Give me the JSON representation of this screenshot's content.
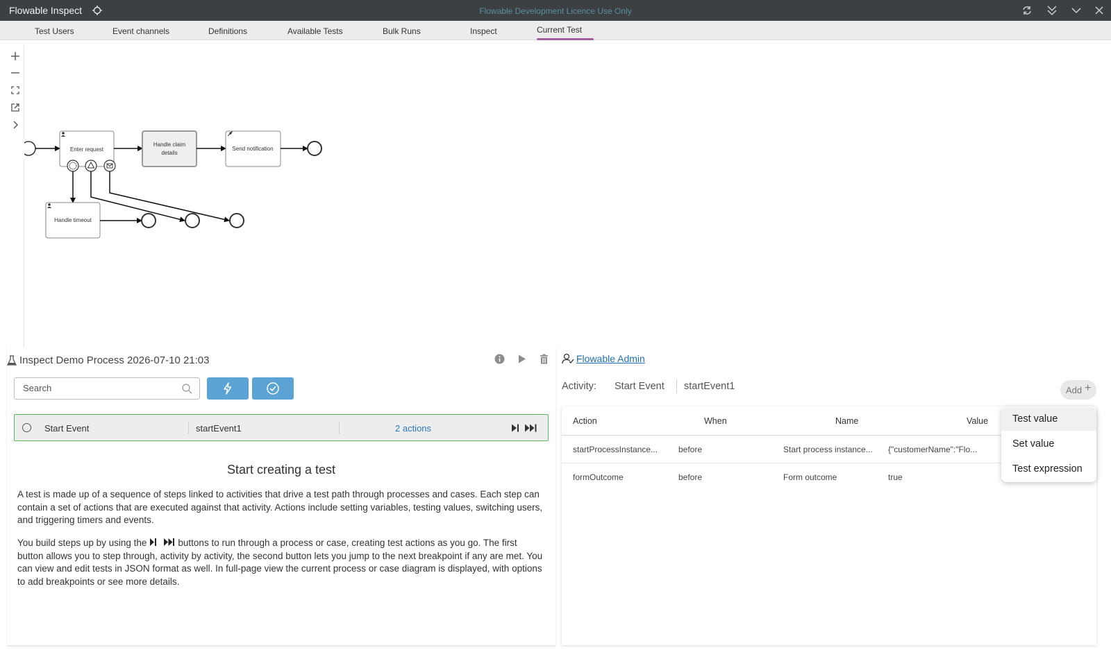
{
  "window": {
    "app_title": "Flowable Inspect",
    "licence_notice": "Flowable Development Licence Use Only",
    "icons": [
      "refresh-icon",
      "collapse-all-icon",
      "chevron-down-icon",
      "close-icon"
    ]
  },
  "tabs": [
    {
      "label": "Test Users"
    },
    {
      "label": "Event channels"
    },
    {
      "label": "Definitions"
    },
    {
      "label": "Available Tests"
    },
    {
      "label": "Bulk Runs"
    },
    {
      "label": "Inspect"
    },
    {
      "label": "Current Test",
      "active": true
    }
  ],
  "diagram": {
    "tools": [
      "zoom-in-icon",
      "zoom-out-icon",
      "fit-icon",
      "open-external-icon",
      "expand-icon"
    ],
    "tasks": {
      "enter_request": "Enter request",
      "handle_claim_line1": "Handle claim",
      "handle_claim_line2": "details",
      "send_notification": "Send notification",
      "handle_timeout": "Handle timeout"
    }
  },
  "test": {
    "title": "Inspect Demo Process 2026-07-10 21:03",
    "search_placeholder": "Search",
    "step": {
      "name": "Start Event",
      "id": "startEvent1",
      "actions": "2 actions"
    }
  },
  "intro": {
    "heading": "Start creating a test",
    "paragraph1": "A test is made up of a sequence of steps linked to activities that drive a test path through processes and cases. Each step can contain a set of actions that are executed against that activity. Actions include setting variables, testing values, switching users, and triggering timers and events.",
    "paragraph2_before": "You build steps up by using the ",
    "paragraph2_after": " buttons to run through a process or case, creating test actions as you go. The first button allows you to step through, activity by activity, the second button lets you jump to the next breakpoint if any are met. You can view and edit tests in JSON format as well. In full-page view the current process or case diagram is displayed, with options to add breakpoints or see more details."
  },
  "user": {
    "name": "Flowable Admin"
  },
  "activity": {
    "label": "Activity:",
    "name": "Start Event",
    "id": "startEvent1",
    "add_label": "Add"
  },
  "actions_table": {
    "headers": [
      "Action",
      "When",
      "Name",
      "Value"
    ],
    "rows": [
      {
        "action": "startProcessInstance...",
        "when": "before",
        "name": "Start process instance...",
        "value": "{\"customerName\":\"Flo..."
      },
      {
        "action": "formOutcome",
        "when": "before",
        "name": "Form outcome",
        "value": "true"
      }
    ]
  },
  "add_menu": {
    "items": [
      "Test value",
      "Set value",
      "Test expression"
    ]
  }
}
